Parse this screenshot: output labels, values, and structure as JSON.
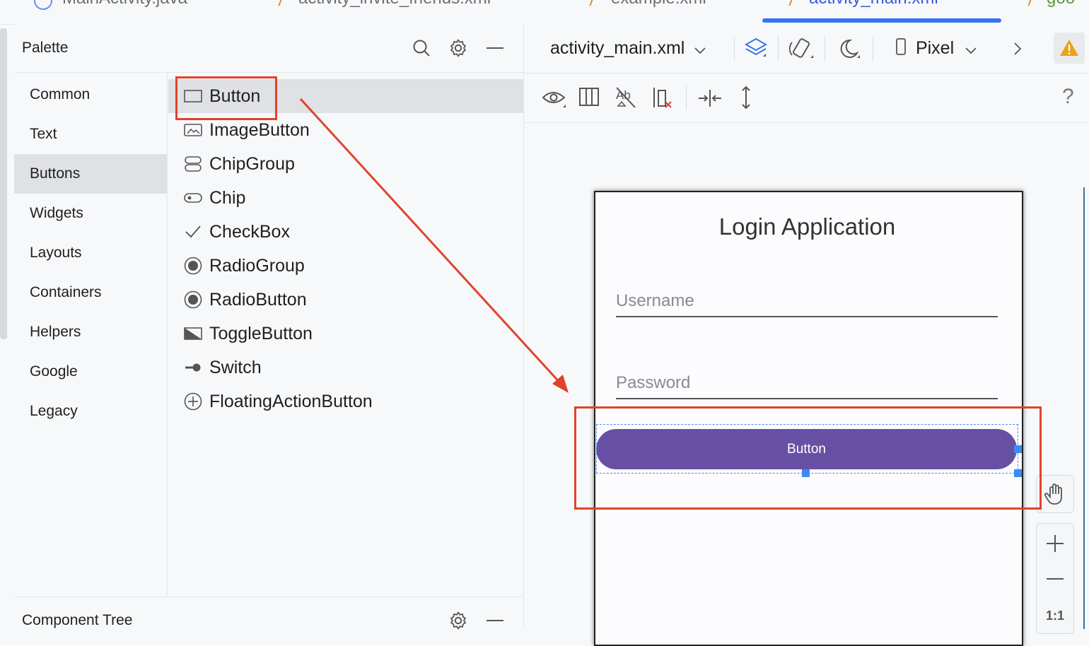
{
  "tabs": [
    {
      "label": "MainActivity.java",
      "active": false
    },
    {
      "label": "activity_invite_friends.xml",
      "active": false
    },
    {
      "label": "example.xml",
      "active": false
    },
    {
      "label": "activity_main.xml",
      "active": true
    },
    {
      "label": "goo",
      "active": false
    }
  ],
  "palette": {
    "title": "Palette",
    "categories": [
      "Common",
      "Text",
      "Buttons",
      "Widgets",
      "Layouts",
      "Containers",
      "Helpers",
      "Google",
      "Legacy"
    ],
    "selected_category": "Buttons",
    "items": [
      {
        "label": "Button",
        "icon": "button-icon"
      },
      {
        "label": "ImageButton",
        "icon": "image-button-icon"
      },
      {
        "label": "ChipGroup",
        "icon": "chip-group-icon"
      },
      {
        "label": "Chip",
        "icon": "chip-icon"
      },
      {
        "label": "CheckBox",
        "icon": "checkbox-icon"
      },
      {
        "label": "RadioGroup",
        "icon": "radio-group-icon"
      },
      {
        "label": "RadioButton",
        "icon": "radio-button-icon"
      },
      {
        "label": "ToggleButton",
        "icon": "toggle-button-icon"
      },
      {
        "label": "Switch",
        "icon": "switch-icon"
      },
      {
        "label": "FloatingActionButton",
        "icon": "fab-icon"
      }
    ],
    "selected_item": "Button"
  },
  "component_tree": {
    "title": "Component Tree"
  },
  "editor": {
    "file_dropdown": "activity_main.xml",
    "device_dropdown": "Pixel",
    "help_label": "?",
    "zoom_one_to_one": "1:1"
  },
  "phone": {
    "title": "Login Application",
    "username_hint": "Username",
    "password_hint": "Password",
    "button_label": "Button"
  },
  "colors": {
    "accent": "#3574f0",
    "annotation_red": "#e0432b",
    "button_purple": "#6750a4",
    "selection_blue": "#3d8af7"
  }
}
